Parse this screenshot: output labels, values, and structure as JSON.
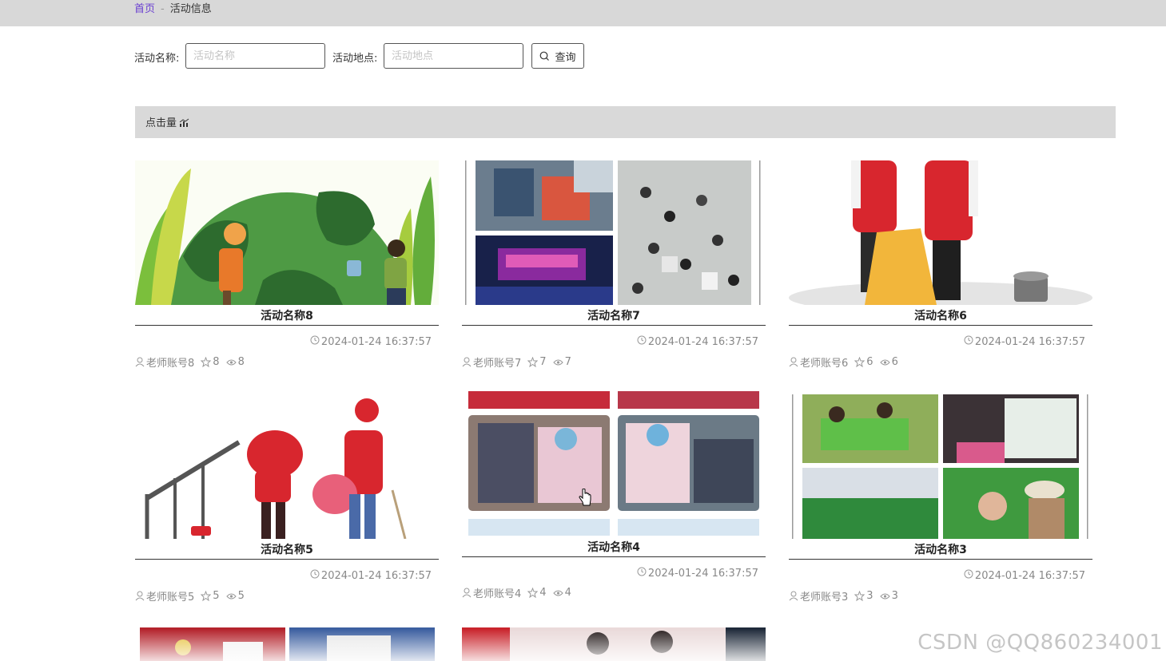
{
  "breadcrumb": {
    "home": "首页",
    "separator": "-",
    "current": "活动信息"
  },
  "filters": {
    "name_label": "活动名称:",
    "name_placeholder": "活动名称",
    "location_label": "活动地点:",
    "location_placeholder": "活动地点",
    "query_label": "查询"
  },
  "sort": {
    "label": "点击量"
  },
  "cards": [
    {
      "title": "活动名称8",
      "time": "2024-01-24 16:37:57",
      "account": "老师账号8",
      "favorites": "8",
      "views": "8"
    },
    {
      "title": "活动名称7",
      "time": "2024-01-24 16:37:57",
      "account": "老师账号7",
      "favorites": "7",
      "views": "7"
    },
    {
      "title": "活动名称6",
      "time": "2024-01-24 16:37:57",
      "account": "老师账号6",
      "favorites": "6",
      "views": "6"
    },
    {
      "title": "活动名称5",
      "time": "2024-01-24 16:37:57",
      "account": "老师账号5",
      "favorites": "5",
      "views": "5"
    },
    {
      "title": "活动名称4",
      "time": "2024-01-24 16:37:57",
      "account": "老师账号4",
      "favorites": "4",
      "views": "4"
    },
    {
      "title": "活动名称3",
      "time": "2024-01-24 16:37:57",
      "account": "老师账号3",
      "favorites": "3",
      "views": "3"
    }
  ],
  "watermark": "CSDN @QQ860234001"
}
